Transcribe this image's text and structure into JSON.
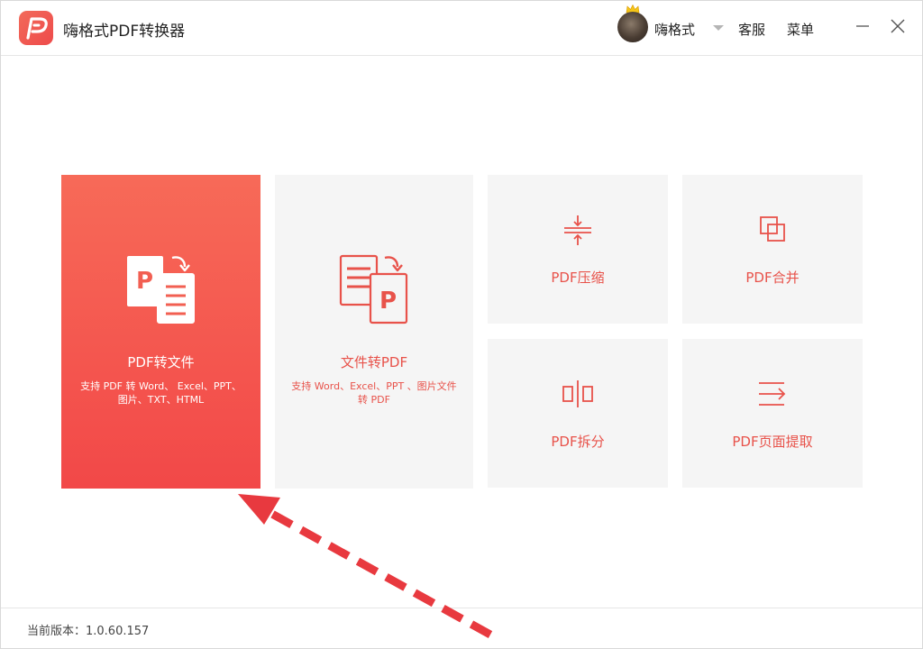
{
  "app": {
    "title": "嗨格式PDF转换器",
    "accent_color": "#ee4b4b"
  },
  "header": {
    "username": "嗨格式",
    "service_label": "客服",
    "menu_label": "菜单"
  },
  "cards": {
    "pdf_to_file": {
      "title": "PDF转文件",
      "desc": "支持 PDF 转 Word、 Excel、PPT、图片、TXT、HTML"
    },
    "file_to_pdf": {
      "title": "文件转PDF",
      "desc": "支持 Word、Excel、PPT 、图片文件转 PDF"
    },
    "compress": {
      "title": "PDF压缩"
    },
    "merge": {
      "title": "PDF合并"
    },
    "split": {
      "title": "PDF拆分"
    },
    "extract": {
      "title": "PDF页面提取"
    }
  },
  "footer": {
    "version": "当前版本：1.0.60.157"
  }
}
